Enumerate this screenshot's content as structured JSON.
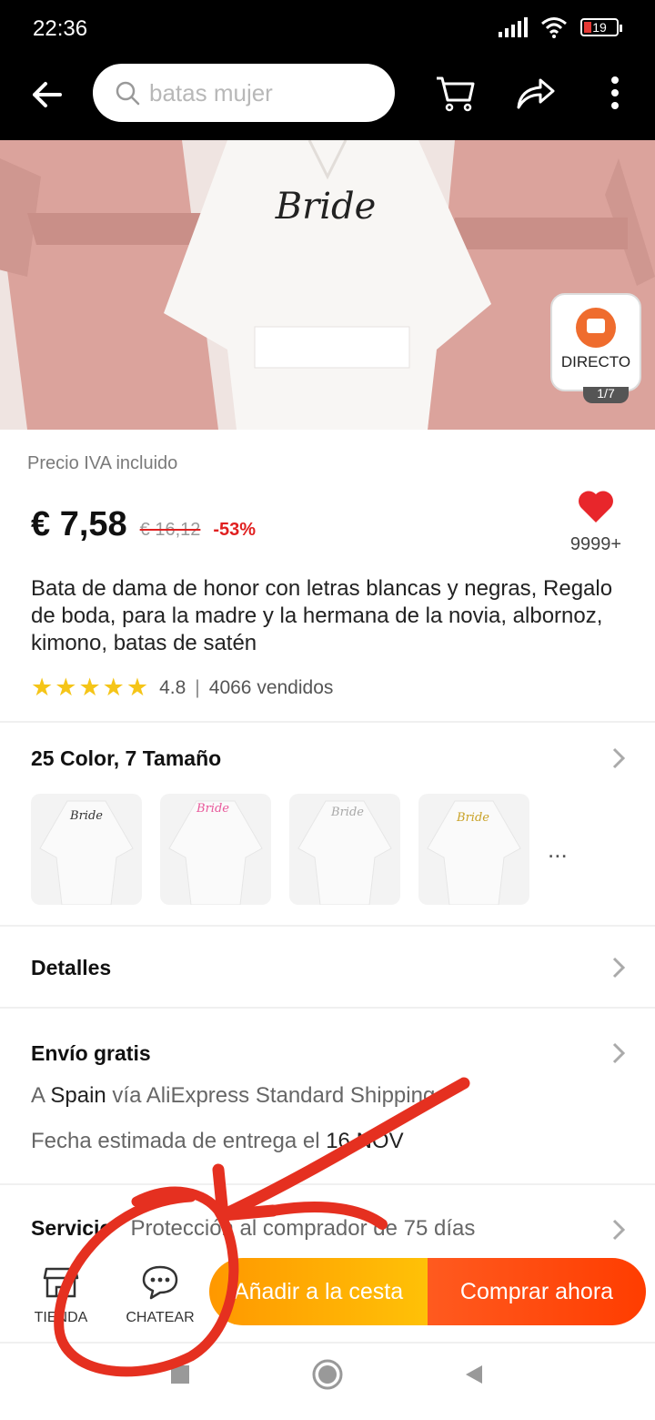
{
  "status_bar": {
    "time": "22:36",
    "battery": "19"
  },
  "search": {
    "placeholder": "batas mujer"
  },
  "hero": {
    "badge_label": "DIRECTO",
    "image_counter": "1/7",
    "print_text": "Bride"
  },
  "price": {
    "vat_note": "Precio IVA incluido",
    "current": "€ 7,58",
    "original": "€ 16,12",
    "discount": "-53%",
    "wishlist_count": "9999+"
  },
  "product": {
    "title": "Bata de dama de honor con letras blancas y negras, Regalo de boda, para la madre y la hermana de la novia, albornoz, kimono, batas de satén",
    "rating": "4.8",
    "sold": "4066 vendidos"
  },
  "variants": {
    "title": "25 Color, 7 Tamaño",
    "thumbs": [
      {
        "text": "Bride",
        "color": "#333333"
      },
      {
        "text": "Bride",
        "color": "#e8589a"
      },
      {
        "text": "Bride",
        "color": "#a8a8a8"
      },
      {
        "text": "Bride",
        "color": "#c9a227"
      }
    ],
    "more": "..."
  },
  "details": {
    "title": "Detalles"
  },
  "shipping": {
    "title": "Envío gratis",
    "line1_a": "A ",
    "line1_country": "Spain",
    "line1_b": " vía AliExpress Standard Shipping",
    "line2_a": "Fecha estimada de entrega el ",
    "line2_date": "16 NOV"
  },
  "service": {
    "title": "Servicio",
    "text": "Protección al comprador de 75 días"
  },
  "actions": {
    "store_label": "TIENDA",
    "chat_label": "CHATEAR",
    "cart_label": "Añadir a la cesta",
    "buy_label": "Comprar ahora"
  },
  "colors": {
    "accent_orange": "#ff9800",
    "buy_red": "#ff3d00",
    "heart": "#e8262b",
    "annotation": "#e53020"
  }
}
